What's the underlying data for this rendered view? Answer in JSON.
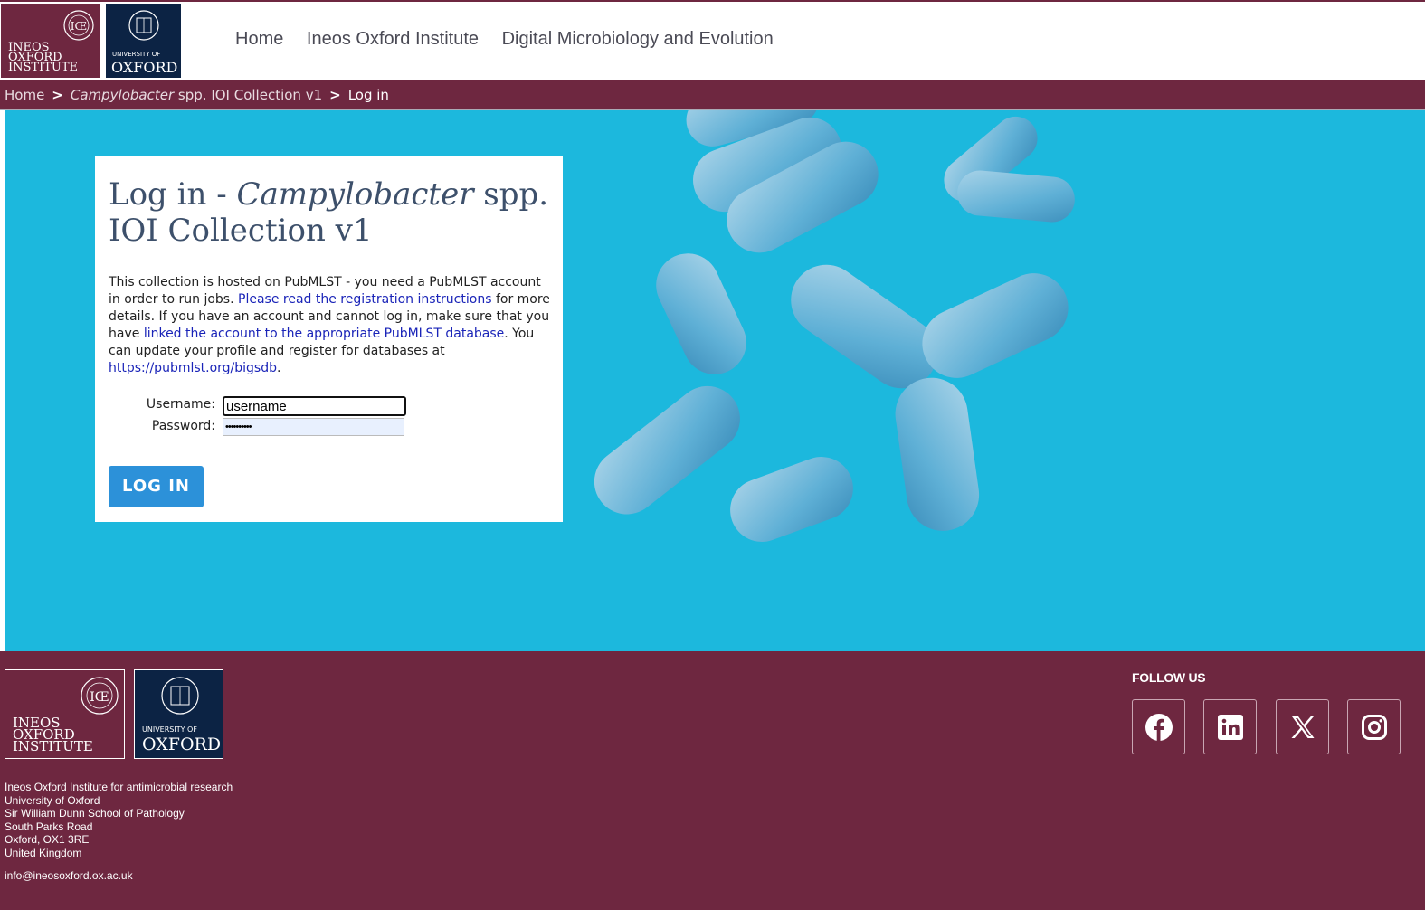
{
  "logos": {
    "ioi_lines": [
      "INEOS",
      "OXFORD",
      "INSTITUTE"
    ],
    "oxford_small": "UNIVERSITY OF",
    "oxford_big": "OXFORD"
  },
  "nav": {
    "items": [
      "Home",
      "Ineos Oxford Institute",
      "Digital Microbiology and Evolution"
    ]
  },
  "breadcrumb": {
    "home": "Home",
    "collection_italic": "Campylobacter",
    "collection_rest": "spp. IOI Collection v1",
    "current": "Log in",
    "separator": ">"
  },
  "login": {
    "title_prefix": "Log in - ",
    "title_italic": "Campylobacter",
    "title_suffix": " spp. IOI Collection v1",
    "info_1": "This collection is hosted on PubMLST - you need a PubMLST account in order to run jobs. ",
    "link_registration": "Please read the registration instructions",
    "info_2": " for more details. If you have an account and cannot log in, make sure that you have ",
    "link_linked": "linked the account to the appropriate PubMLST database",
    "info_3": ". You can update your profile and register for databases at ",
    "link_bigsdb": "https://pubmlst.org/bigsdb",
    "info_4": ".",
    "username_label": "Username:",
    "username_value": "username",
    "password_label": "Password:",
    "password_value": "••••••••••",
    "button": "LOG IN"
  },
  "footer": {
    "address": [
      "Ineos Oxford Institute for antimicrobial research",
      "University of Oxford",
      "Sir William Dunn School of Pathology",
      "South Parks Road",
      "Oxford, OX1 3RE",
      "United Kingdom"
    ],
    "email": "info@ineosoxford.ox.ac.uk",
    "follow_title": "FOLLOW US",
    "social": [
      "facebook-icon",
      "linkedin-icon",
      "x-icon",
      "instagram-icon"
    ]
  },
  "colors": {
    "brand_maroon": "#6e2740",
    "oxford_blue": "#0c2344",
    "hero_cyan": "#1cb8dd",
    "button_blue": "#2c91d9"
  }
}
